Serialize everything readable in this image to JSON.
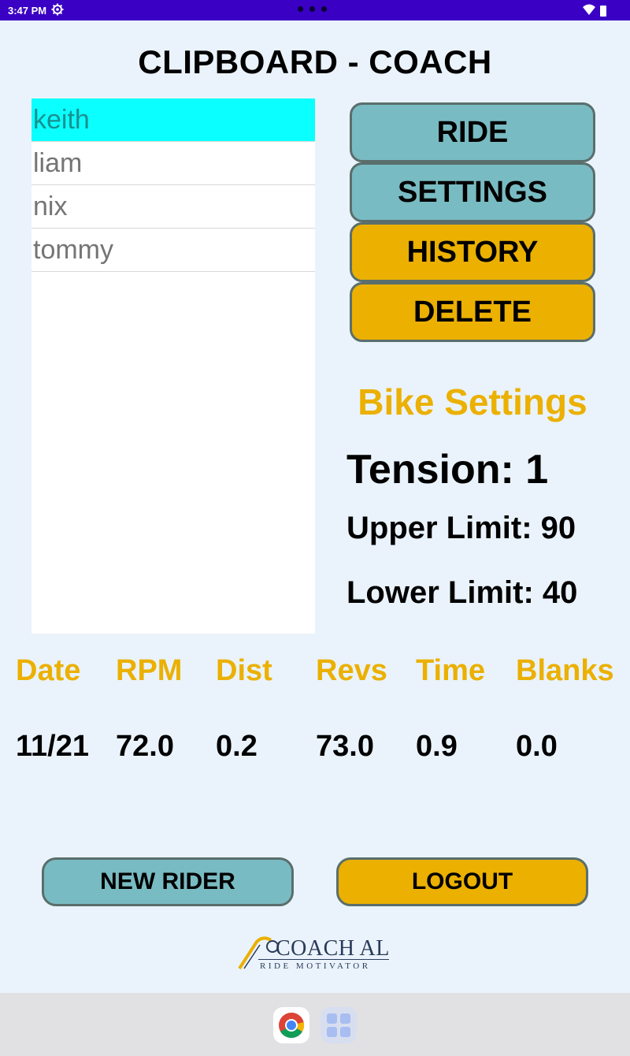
{
  "status_bar": {
    "time": "3:47 PM"
  },
  "page": {
    "title": "CLIPBOARD - COACH"
  },
  "riders": [
    {
      "name": "keith",
      "selected": true
    },
    {
      "name": "liam",
      "selected": false
    },
    {
      "name": "nix",
      "selected": false
    },
    {
      "name": "tommy",
      "selected": false
    }
  ],
  "actions": {
    "ride": "RIDE",
    "settings": "SETTINGS",
    "history": "HISTORY",
    "delete": "DELETE"
  },
  "bike_settings": {
    "heading": "Bike Settings",
    "tension": "Tension: 1",
    "upper_limit": "Upper Limit: 90",
    "lower_limit": "Lower Limit: 40"
  },
  "history": {
    "headers": [
      "Date",
      "RPM",
      "Dist",
      "Revs",
      "Time",
      "Blanks"
    ],
    "row": [
      "11/21",
      "72.0",
      "0.2",
      "73.0",
      "0.9",
      "0.0"
    ]
  },
  "footer": {
    "new_rider": "NEW RIDER",
    "logout": "LOGOUT"
  },
  "logo": {
    "name": "COACH AL",
    "tagline": "RIDE MOTIVATOR"
  },
  "colors": {
    "accent_gold": "#ebb000",
    "accent_teal": "#79bbc2",
    "selected_row": "#0affff",
    "status_bar": "#3a00c4"
  },
  "icons": {
    "status_settings": "gear-icon",
    "status_wifi": "wifi-icon",
    "status_battery": "battery-icon",
    "nav_browser": "chrome-icon",
    "nav_apps": "app-drawer-icon"
  }
}
